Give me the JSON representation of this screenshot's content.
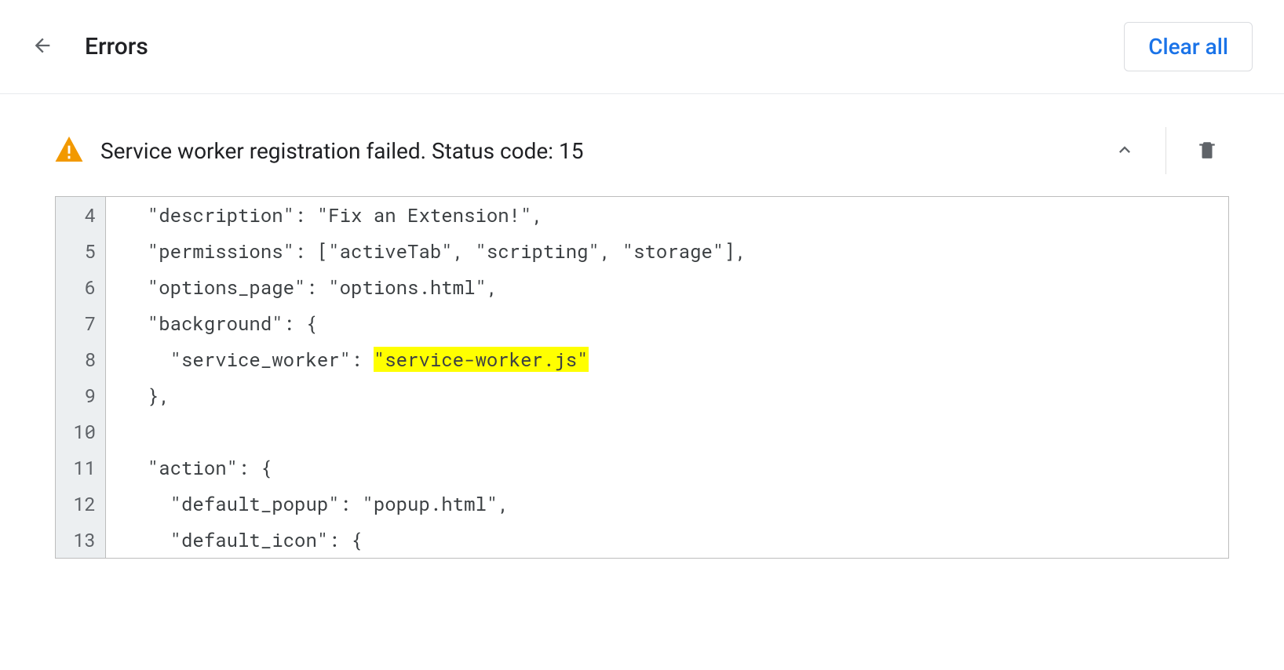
{
  "header": {
    "title": "Errors",
    "clear_all_label": "Clear all"
  },
  "error": {
    "message": "Service worker registration failed. Status code: 15"
  },
  "code": {
    "lines": [
      {
        "num": 4,
        "indent": "  ",
        "text_before": "\"description\": \"Fix an Extension!\",",
        "highlight": "",
        "text_after": ""
      },
      {
        "num": 5,
        "indent": "  ",
        "text_before": "\"permissions\": [\"activeTab\", \"scripting\", \"storage\"],",
        "highlight": "",
        "text_after": ""
      },
      {
        "num": 6,
        "indent": "  ",
        "text_before": "\"options_page\": \"options.html\",",
        "highlight": "",
        "text_after": ""
      },
      {
        "num": 7,
        "indent": "  ",
        "text_before": "\"background\": {",
        "highlight": "",
        "text_after": ""
      },
      {
        "num": 8,
        "indent": "    ",
        "text_before": "\"service_worker\": ",
        "highlight": "\"service-worker.js\"",
        "text_after": ""
      },
      {
        "num": 9,
        "indent": "  ",
        "text_before": "},",
        "highlight": "",
        "text_after": ""
      },
      {
        "num": 10,
        "indent": "",
        "text_before": "",
        "highlight": "",
        "text_after": ""
      },
      {
        "num": 11,
        "indent": "  ",
        "text_before": "\"action\": {",
        "highlight": "",
        "text_after": ""
      },
      {
        "num": 12,
        "indent": "    ",
        "text_before": "\"default_popup\": \"popup.html\",",
        "highlight": "",
        "text_after": ""
      },
      {
        "num": 13,
        "indent": "    ",
        "text_before": "\"default_icon\": {",
        "highlight": "",
        "text_after": ""
      }
    ]
  }
}
